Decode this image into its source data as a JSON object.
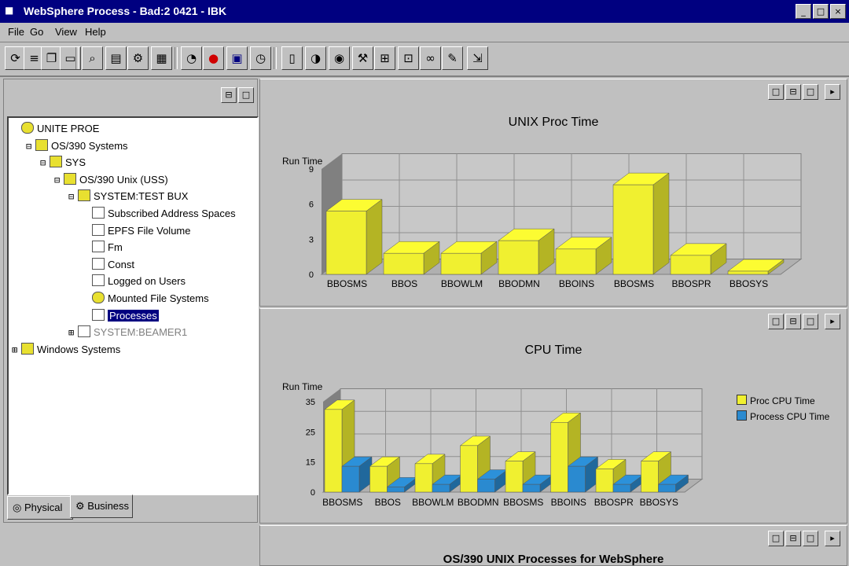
{
  "window": {
    "title": "WebSphere Process - Bad:2 0421 - IBK",
    "controls": [
      "_",
      "□",
      "×"
    ]
  },
  "menu": [
    "File",
    "Go",
    "View",
    "Help"
  ],
  "toolbar": {
    "buttons": [
      "refresh-icon",
      "properties-icon",
      "copy-icon",
      "open-icon",
      "find-icon",
      "print-icon",
      "settings-icon",
      "grid-icon",
      "search-icon",
      "stop-icon",
      "chart-icon",
      "clock-icon",
      "page-icon",
      "gauge-icon",
      "monitor-icon",
      "wrench-icon",
      "tree-icon",
      "window-icon",
      "link-icon",
      "tools-icon",
      "export-icon"
    ]
  },
  "tree": {
    "items": [
      {
        "exp": "",
        "icon": "db",
        "label": "UNITE PROE",
        "indent": 0
      },
      {
        "exp": "⊟",
        "icon": "folder",
        "label": "OS/390 Systems",
        "indent": 1
      },
      {
        "exp": "⊟",
        "icon": "folder",
        "label": "SYS",
        "indent": 2
      },
      {
        "exp": "⊟",
        "icon": "folder",
        "label": "OS/390 Unix (USS)",
        "indent": 3
      },
      {
        "exp": "⊟",
        "icon": "folder",
        "label": "SYSTEM:TEST BUX",
        "indent": 4
      },
      {
        "exp": "",
        "icon": "dev",
        "label": "Subscribed Address Spaces",
        "indent": 5
      },
      {
        "exp": "",
        "icon": "dev",
        "label": "EPFS File Volume",
        "indent": 5
      },
      {
        "exp": "",
        "icon": "dev",
        "label": "Fm",
        "indent": 5
      },
      {
        "exp": "",
        "icon": "dev",
        "label": "Const",
        "indent": 5
      },
      {
        "exp": "",
        "icon": "dev",
        "label": "Logged on Users",
        "indent": 5
      },
      {
        "exp": "",
        "icon": "db",
        "label": "Mounted File Systems",
        "indent": 5
      },
      {
        "exp": "",
        "icon": "dev",
        "label": "Processes",
        "indent": 5,
        "selected": true
      },
      {
        "exp": "⊞",
        "icon": "dev",
        "label": "SYSTEM:BEAMER1",
        "indent": 4,
        "dim": true
      },
      {
        "exp": "⊞",
        "icon": "folder",
        "label": "Windows Systems",
        "indent": 0
      }
    ]
  },
  "tabs": [
    "Physical",
    "Business"
  ],
  "chart1": {
    "controls": [
      "□",
      "⊟",
      "□",
      "▸"
    ]
  },
  "chart2": {
    "controls": [
      "□",
      "⊟",
      "□",
      "▸"
    ],
    "legend_colors": [
      "#f0f030",
      "#2a8ad0"
    ]
  },
  "bottom_panel": {
    "title": "OS/390 UNIX Processes for WebSphere",
    "controls": [
      "□",
      "⊟",
      "□",
      "▸"
    ]
  },
  "colors": {
    "bar_yellow": "#f0f030",
    "bar_blue": "#2a8ad0",
    "title_bar": "#000080"
  },
  "chart_data": [
    {
      "type": "bar",
      "title": "UNIX Proc Time",
      "ylabel": "Run Time",
      "categories": [
        "BBOSMS",
        "BBOS",
        "BBOWLM",
        "BBODMN",
        "BBOINS",
        "BBOSMS",
        "BBOSPR",
        "BBOSYS"
      ],
      "values": [
        6,
        2,
        2,
        3.2,
        2.4,
        8.5,
        1.8,
        0.3
      ],
      "ytick_labels": [
        "0",
        "3",
        "6",
        "9"
      ],
      "ylim": [
        0,
        10
      ]
    },
    {
      "type": "bar",
      "title": "CPU Time",
      "ylabel": "Run Time",
      "categories": [
        "BBOSMS",
        "BBOS",
        "BBOWLM",
        "BBODMN",
        "BBOSMS",
        "BBOINS",
        "BBOSPR",
        "BBOSYS"
      ],
      "series": [
        {
          "name": "Process CPU Time",
          "values": [
            32,
            10,
            11,
            18,
            12,
            27,
            9,
            12
          ]
        },
        {
          "name": "Process CPU Time",
          "values": [
            10,
            2,
            3,
            5,
            3,
            10,
            3,
            3
          ]
        }
      ],
      "legend_labels": [
        "Proc CPU Time",
        "Process CPU Time"
      ],
      "ytick_labels": [
        "0",
        "15",
        "25",
        "35"
      ],
      "ylim": [
        0,
        35
      ]
    }
  ]
}
